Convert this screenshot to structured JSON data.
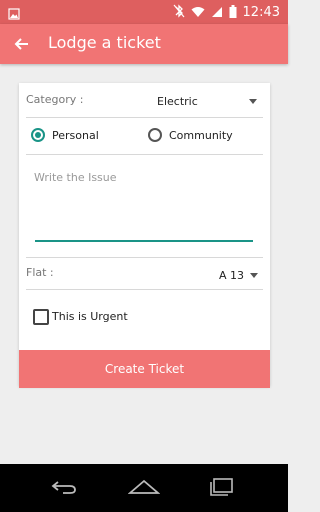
{
  "status_bar": {
    "time": "12:43",
    "icons": [
      "image-icon",
      "bluetooth-mute-icon",
      "wifi-icon",
      "signal-icon",
      "battery-icon"
    ]
  },
  "app_bar": {
    "title": "Lodge a ticket",
    "back_icon": "back-arrow-icon"
  },
  "form": {
    "category": {
      "label": "Category :",
      "value": "Electric"
    },
    "type": {
      "options": [
        "Personal",
        "Community"
      ],
      "selected": "Personal"
    },
    "issue": {
      "placeholder": "Write the Issue",
      "value": ""
    },
    "flat": {
      "label": "Flat :",
      "value": "A 13"
    },
    "urgent": {
      "label": "This is Urgent",
      "checked": false
    }
  },
  "create_button": {
    "label": "Create Ticket"
  },
  "nav": {
    "icons": [
      "back-icon",
      "home-icon",
      "recents-icon"
    ]
  },
  "colors": {
    "accent": "#f17474",
    "status_bar": "#de5f5f",
    "teal": "#1a9487"
  }
}
